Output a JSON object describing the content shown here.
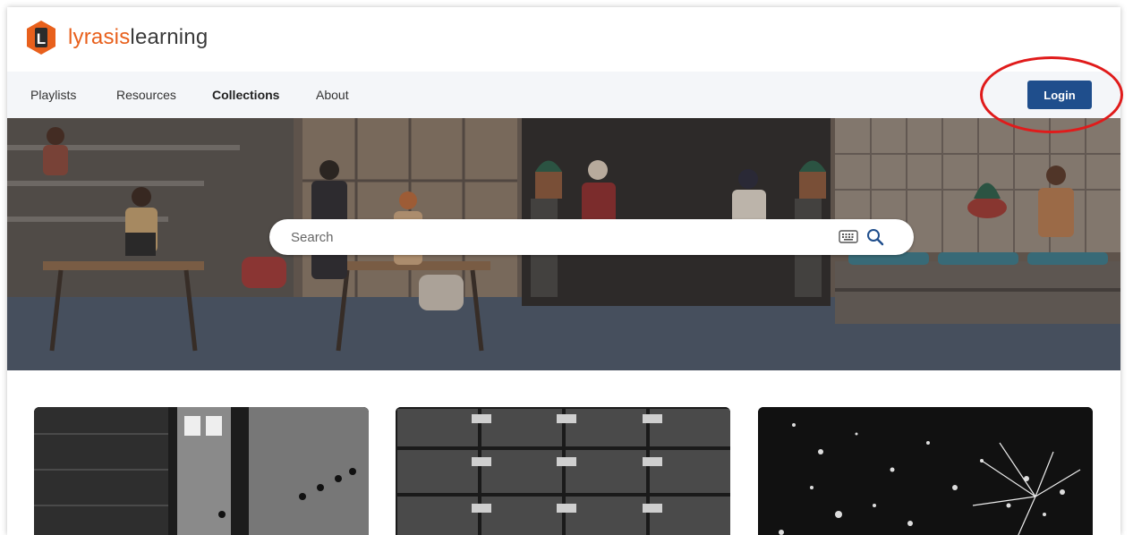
{
  "header": {
    "logo": {
      "brand": "lyrasis",
      "suffix": "learning",
      "mark": "L"
    }
  },
  "nav": {
    "items": [
      {
        "label": "Playlists"
      },
      {
        "label": "Resources"
      },
      {
        "label": "Collections",
        "active": true
      },
      {
        "label": "About"
      }
    ],
    "login_label": "Login"
  },
  "search": {
    "placeholder": "Search"
  },
  "icons": [
    "keyboard-icon",
    "search-icon"
  ],
  "colors": {
    "brand_orange": "#e8601c",
    "login_blue": "#1f4e8c",
    "annotation_red": "#e01b1b"
  },
  "collections": [
    {
      "image": "library-compact-shelving-photo"
    },
    {
      "image": "card-catalog-drawers-photo"
    },
    {
      "image": "sparks-bokeh-photo"
    }
  ]
}
